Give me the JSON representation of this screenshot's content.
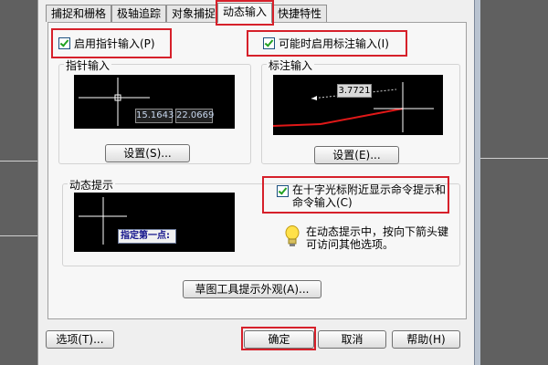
{
  "tabs": [
    "捕捉和栅格",
    "极轴追踪",
    "对象捕捉",
    "动态输入",
    "快捷特性"
  ],
  "active_tab": "动态输入",
  "pointer_input": {
    "checkbox_label": "启用指针输入(P)",
    "checked": true,
    "group_title": "指针输入",
    "coord_x": "15.1643",
    "coord_y": "22.0669",
    "settings_button": "设置(S)..."
  },
  "dimension_input": {
    "checkbox_label": "可能时启用标注输入(I)",
    "checked": true,
    "group_title": "标注输入",
    "value": "3.7721",
    "settings_button": "设置(E)..."
  },
  "dynamic_prompt": {
    "group_title": "动态提示",
    "preview_text": "指定第一点:",
    "checkbox_label": "在十字光标附近显示命令提示和命令输入(C)",
    "checked": true,
    "hint_text": "在动态提示中，按向下箭头键可访问其他选项。",
    "icon": "lightbulb-icon"
  },
  "tooltip_button": "草图工具提示外观(A)...",
  "footer": {
    "options_button": "选项(T)...",
    "ok_button": "确定",
    "cancel_button": "取消",
    "help_button": "帮助(H)"
  },
  "colors": {
    "highlight": "#d6202a",
    "preview_bg": "#000000",
    "dimension_line": "#e01818"
  }
}
